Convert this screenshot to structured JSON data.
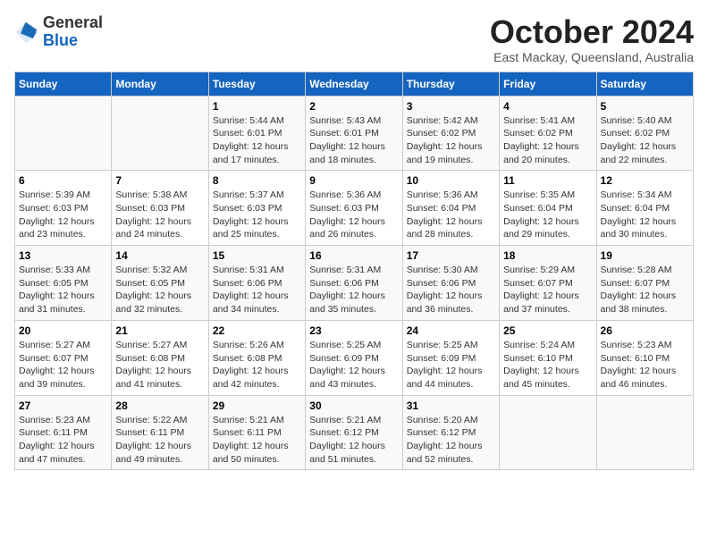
{
  "header": {
    "logo_line1": "General",
    "logo_line2": "Blue",
    "month": "October 2024",
    "location": "East Mackay, Queensland, Australia"
  },
  "days_of_week": [
    "Sunday",
    "Monday",
    "Tuesday",
    "Wednesday",
    "Thursday",
    "Friday",
    "Saturday"
  ],
  "weeks": [
    [
      {
        "day": "",
        "content": ""
      },
      {
        "day": "",
        "content": ""
      },
      {
        "day": "1",
        "content": "Sunrise: 5:44 AM\nSunset: 6:01 PM\nDaylight: 12 hours and 17 minutes."
      },
      {
        "day": "2",
        "content": "Sunrise: 5:43 AM\nSunset: 6:01 PM\nDaylight: 12 hours and 18 minutes."
      },
      {
        "day": "3",
        "content": "Sunrise: 5:42 AM\nSunset: 6:02 PM\nDaylight: 12 hours and 19 minutes."
      },
      {
        "day": "4",
        "content": "Sunrise: 5:41 AM\nSunset: 6:02 PM\nDaylight: 12 hours and 20 minutes."
      },
      {
        "day": "5",
        "content": "Sunrise: 5:40 AM\nSunset: 6:02 PM\nDaylight: 12 hours and 22 minutes."
      }
    ],
    [
      {
        "day": "6",
        "content": "Sunrise: 5:39 AM\nSunset: 6:03 PM\nDaylight: 12 hours and 23 minutes."
      },
      {
        "day": "7",
        "content": "Sunrise: 5:38 AM\nSunset: 6:03 PM\nDaylight: 12 hours and 24 minutes."
      },
      {
        "day": "8",
        "content": "Sunrise: 5:37 AM\nSunset: 6:03 PM\nDaylight: 12 hours and 25 minutes."
      },
      {
        "day": "9",
        "content": "Sunrise: 5:36 AM\nSunset: 6:03 PM\nDaylight: 12 hours and 26 minutes."
      },
      {
        "day": "10",
        "content": "Sunrise: 5:36 AM\nSunset: 6:04 PM\nDaylight: 12 hours and 28 minutes."
      },
      {
        "day": "11",
        "content": "Sunrise: 5:35 AM\nSunset: 6:04 PM\nDaylight: 12 hours and 29 minutes."
      },
      {
        "day": "12",
        "content": "Sunrise: 5:34 AM\nSunset: 6:04 PM\nDaylight: 12 hours and 30 minutes."
      }
    ],
    [
      {
        "day": "13",
        "content": "Sunrise: 5:33 AM\nSunset: 6:05 PM\nDaylight: 12 hours and 31 minutes."
      },
      {
        "day": "14",
        "content": "Sunrise: 5:32 AM\nSunset: 6:05 PM\nDaylight: 12 hours and 32 minutes."
      },
      {
        "day": "15",
        "content": "Sunrise: 5:31 AM\nSunset: 6:06 PM\nDaylight: 12 hours and 34 minutes."
      },
      {
        "day": "16",
        "content": "Sunrise: 5:31 AM\nSunset: 6:06 PM\nDaylight: 12 hours and 35 minutes."
      },
      {
        "day": "17",
        "content": "Sunrise: 5:30 AM\nSunset: 6:06 PM\nDaylight: 12 hours and 36 minutes."
      },
      {
        "day": "18",
        "content": "Sunrise: 5:29 AM\nSunset: 6:07 PM\nDaylight: 12 hours and 37 minutes."
      },
      {
        "day": "19",
        "content": "Sunrise: 5:28 AM\nSunset: 6:07 PM\nDaylight: 12 hours and 38 minutes."
      }
    ],
    [
      {
        "day": "20",
        "content": "Sunrise: 5:27 AM\nSunset: 6:07 PM\nDaylight: 12 hours and 39 minutes."
      },
      {
        "day": "21",
        "content": "Sunrise: 5:27 AM\nSunset: 6:08 PM\nDaylight: 12 hours and 41 minutes."
      },
      {
        "day": "22",
        "content": "Sunrise: 5:26 AM\nSunset: 6:08 PM\nDaylight: 12 hours and 42 minutes."
      },
      {
        "day": "23",
        "content": "Sunrise: 5:25 AM\nSunset: 6:09 PM\nDaylight: 12 hours and 43 minutes."
      },
      {
        "day": "24",
        "content": "Sunrise: 5:25 AM\nSunset: 6:09 PM\nDaylight: 12 hours and 44 minutes."
      },
      {
        "day": "25",
        "content": "Sunrise: 5:24 AM\nSunset: 6:10 PM\nDaylight: 12 hours and 45 minutes."
      },
      {
        "day": "26",
        "content": "Sunrise: 5:23 AM\nSunset: 6:10 PM\nDaylight: 12 hours and 46 minutes."
      }
    ],
    [
      {
        "day": "27",
        "content": "Sunrise: 5:23 AM\nSunset: 6:11 PM\nDaylight: 12 hours and 47 minutes."
      },
      {
        "day": "28",
        "content": "Sunrise: 5:22 AM\nSunset: 6:11 PM\nDaylight: 12 hours and 49 minutes."
      },
      {
        "day": "29",
        "content": "Sunrise: 5:21 AM\nSunset: 6:11 PM\nDaylight: 12 hours and 50 minutes."
      },
      {
        "day": "30",
        "content": "Sunrise: 5:21 AM\nSunset: 6:12 PM\nDaylight: 12 hours and 51 minutes."
      },
      {
        "day": "31",
        "content": "Sunrise: 5:20 AM\nSunset: 6:12 PM\nDaylight: 12 hours and 52 minutes."
      },
      {
        "day": "",
        "content": ""
      },
      {
        "day": "",
        "content": ""
      }
    ]
  ]
}
